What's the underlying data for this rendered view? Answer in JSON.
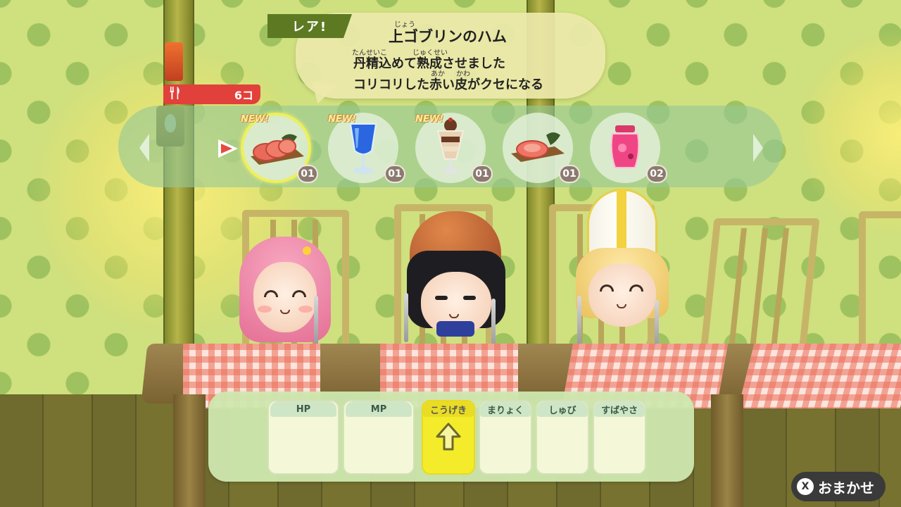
{
  "dialog": {
    "rarity_label": "レア!",
    "item_name_ruby": "じょう",
    "item_name": "上ゴブリンのハム",
    "line1_ruby_a": "たんせいこ",
    "line1_ruby_b": "じゅくせい",
    "line1": "丹精込めて熟成させました",
    "line2_ruby_a": "あか",
    "line2_ruby_b": "かわ",
    "line2": "コリコリした赤い皮がクセになる"
  },
  "food_counter": {
    "icon": "fork-knife-icon",
    "value": "6コ"
  },
  "items": [
    {
      "name": "goblin-ham-icon",
      "badge": "NEW!",
      "qty": "01",
      "selected": true
    },
    {
      "name": "blue-drink-icon",
      "badge": "NEW!",
      "qty": "01",
      "selected": false
    },
    {
      "name": "parfait-icon",
      "badge": "NEW!",
      "qty": "01",
      "selected": false
    },
    {
      "name": "meat-board-icon",
      "badge": "",
      "qty": "01",
      "selected": false
    },
    {
      "name": "pink-jam-icon",
      "badge": "",
      "qty": "02",
      "selected": false
    }
  ],
  "stats": [
    {
      "label": "HP",
      "highlight": false
    },
    {
      "label": "MP",
      "highlight": false
    },
    {
      "label": "こうげき",
      "highlight": true,
      "indicator": "up-arrow-icon"
    },
    {
      "label": "まりょく",
      "highlight": false
    },
    {
      "label": "しゅび",
      "highlight": false
    },
    {
      "label": "すばやさ",
      "highlight": false
    }
  ],
  "omakase": {
    "button_key": "X",
    "label": "おまかせ"
  },
  "colors": {
    "rare_tag": "#5d7a23",
    "counter": "#e2403b",
    "highlight": "#f4ec2a",
    "cursor": "#e74c3c"
  }
}
